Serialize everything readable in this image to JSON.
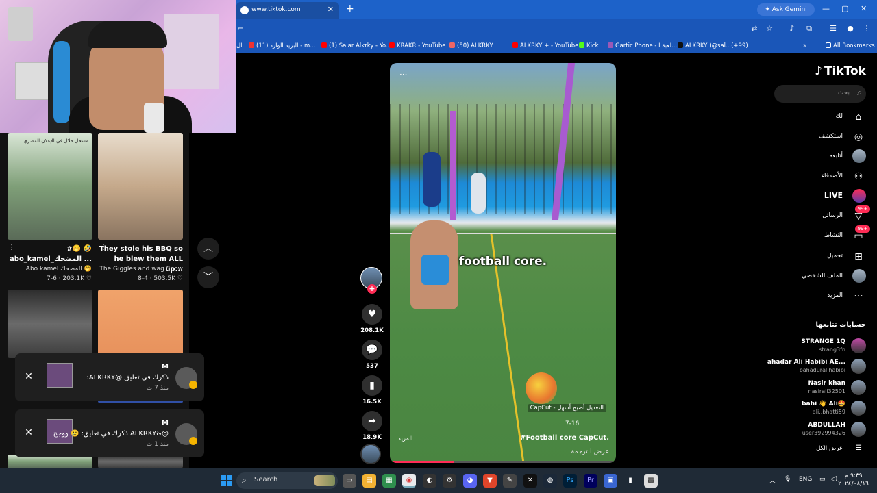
{
  "browser": {
    "tab_title": "www.tiktok.com",
    "new_tab": "+",
    "ask_gemini": "Ask Gemini",
    "bookmarks": [
      {
        "label": "ال",
        "color": "#1a56b8"
      },
      {
        "label": "البريد الوارد (11) - m...",
        "color": "#e33"
      },
      {
        "label": "(1) Salar Alkrky - Yo...",
        "color": "#f00"
      },
      {
        "label": "KRAKR - YouTube",
        "color": "#f00"
      },
      {
        "label": "(50) ALKRKY",
        "color": "#e66"
      },
      {
        "label": "ALKRKY + - YouTube",
        "color": "#f00"
      },
      {
        "label": "Kick",
        "color": "#53fc18"
      },
      {
        "label": "Gartic Phone - لعبة ا...",
        "color": "#9b59b6"
      },
      {
        "label": "ALKRKY (@sal...(+99)",
        "color": "#111"
      }
    ],
    "all_bookmarks": "All Bookmarks"
  },
  "left_panel": {
    "cards": [
      {
        "overlay": "مسحل حلال في الإعلان المصري",
        "title": "#🤭 🤣",
        "subtitle": "abo_kamel_المضحك ...",
        "author": "Abo kamel المضحك 🤭",
        "date": "7-6",
        "likes": "203.1K"
      },
      {
        "overlay": "",
        "title": "They stole his BBQ so",
        "subtitle": "he blew them ALL up...",
        "author": "The Giggles and wag Show",
        "date": "8-4",
        "likes": "503.5K"
      }
    ],
    "notifications": [
      {
        "name": "M",
        "text": ":ALKRKY@ ذكرك في تعليق",
        "time": "منذ 7 ث"
      },
      {
        "name": "M",
        "text": "ذكرك في تعليق: 🥲 ووجح ALKRKY&@",
        "time": "منذ 1 ث"
      }
    ]
  },
  "video": {
    "overlay_text": "football core.",
    "capcut": "CapCut - التعديل أصبح أسهل",
    "date": "7-16 ·",
    "description": "#Football core CapCut.",
    "more": "المزيد",
    "translate": "عرض الترجمة",
    "progress": 0.28,
    "likes": "208.1K",
    "comments": "537",
    "saves": "16.5K",
    "shares": "18.9K"
  },
  "sidebar": {
    "logo": "TikTok",
    "search_placeholder": "بحث",
    "nav": [
      {
        "label": "لك",
        "icon": "⌂"
      },
      {
        "label": "استكشف",
        "icon": "◎"
      },
      {
        "label": "أتابعه",
        "icon": ""
      },
      {
        "label": "الأصدقاء",
        "icon": "👥"
      },
      {
        "label": "LIVE",
        "icon": ""
      },
      {
        "label": "الرسائل",
        "icon": "▽",
        "badge": "99+"
      },
      {
        "label": "النشاط",
        "icon": "▭",
        "badge": "99+"
      },
      {
        "label": "تحميل",
        "icon": "⊞"
      },
      {
        "label": "الملف الشخصي",
        "icon": ""
      },
      {
        "label": "المزيد",
        "icon": "···"
      }
    ],
    "following_title": "حسابات تتابعها",
    "accounts": [
      {
        "name": "STRANGE 1Q",
        "user": "strang3fn"
      },
      {
        "name": "ahadar Ali Habibi AE...",
        "user": "bahadurallhabibi"
      },
      {
        "name": "Nasir khan",
        "user": "nasirali32501"
      },
      {
        "name": "bahi 👋 Ali🤩",
        "user": "ali..bhatti59"
      },
      {
        "name": "ABDULLAH",
        "user": "user392994326"
      }
    ],
    "show_all": "عرض الكل"
  },
  "taskbar": {
    "search": "Search",
    "lang": "ENG",
    "time": "٩:٣٩ م",
    "date": "٢٠٢٤/٠٨/١٦"
  }
}
